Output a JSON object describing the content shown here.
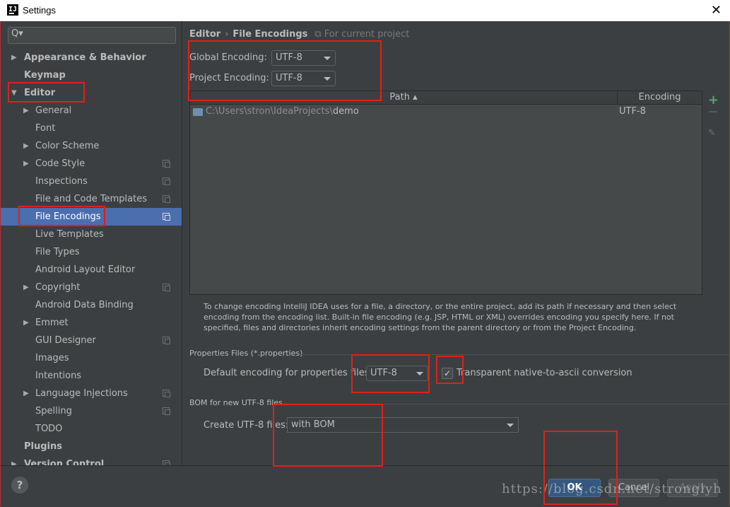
{
  "window": {
    "title": "Settings",
    "app_icon": "IJ",
    "close": "✕"
  },
  "search": {
    "icon": "Q▾",
    "placeholder": ""
  },
  "sidebar": {
    "items": [
      {
        "label": "Appearance & Behavior",
        "arrow": "▶"
      },
      {
        "label": "Keymap"
      },
      {
        "label": "Editor",
        "arrow": "▼"
      },
      {
        "label": "General",
        "arrow": "▶"
      },
      {
        "label": "Font"
      },
      {
        "label": "Color Scheme",
        "arrow": "▶"
      },
      {
        "label": "Code Style",
        "arrow": "▶"
      },
      {
        "label": "Inspections"
      },
      {
        "label": "File and Code Templates"
      },
      {
        "label": "File Encodings"
      },
      {
        "label": "Live Templates"
      },
      {
        "label": "File Types"
      },
      {
        "label": "Android Layout Editor"
      },
      {
        "label": "Copyright",
        "arrow": "▶"
      },
      {
        "label": "Android Data Binding"
      },
      {
        "label": "Emmet",
        "arrow": "▶"
      },
      {
        "label": "GUI Designer"
      },
      {
        "label": "Images"
      },
      {
        "label": "Intentions"
      },
      {
        "label": "Language Injections",
        "arrow": "▶"
      },
      {
        "label": "Spelling"
      },
      {
        "label": "TODO"
      },
      {
        "label": "Plugins"
      },
      {
        "label": "Version Control",
        "arrow": "▶"
      }
    ]
  },
  "breadcrumb": {
    "part1": "Editor",
    "sep": "›",
    "part2": "File Encodings",
    "note": "For current project"
  },
  "encoding": {
    "global_label": "Global Encoding:",
    "global_value": "UTF-8",
    "project_label": "Project Encoding:",
    "project_value": "UTF-8"
  },
  "table": {
    "col_path": "Path ▴",
    "col_encoding": "Encoding",
    "rows": [
      {
        "path_prefix": "C:\\Users\\stron\\IdeaProjects\\",
        "path_name": "demo",
        "encoding": "UTF-8"
      }
    ]
  },
  "toolbar": {
    "add": "+",
    "edit": "✎"
  },
  "info_text": "To change encoding IntelliJ IDEA uses for a file, a directory, or the entire project, add its path if necessary and then select encoding from the encoding list. Built-in file encoding (e.g. JSP, HTML or XML) overrides encoding you specify here. If not specified, files and directories inherit encoding settings from the parent directory or from the Project Encoding.",
  "properties": {
    "section_title": "Properties Files (*.properties)",
    "default_label": "Default encoding for properties files:",
    "default_value": "UTF-8",
    "transparent_checked": "✓",
    "transparent_label": "Transparent native-to-ascii conversion"
  },
  "bom": {
    "section_title": "BOM for new UTF-8 files",
    "create_label": "Create UTF-8 files:",
    "create_value": "with BOM"
  },
  "buttons": {
    "help": "?",
    "ok": "OK",
    "cancel": "Cancel",
    "apply": "Apply"
  },
  "watermark": "https://blog.csdn.net/stronglyh",
  "colors": {
    "selection": "#4b6eaf",
    "highlight": "#e0201a",
    "ok_button": "#365880",
    "add_icon": "#59a869"
  }
}
